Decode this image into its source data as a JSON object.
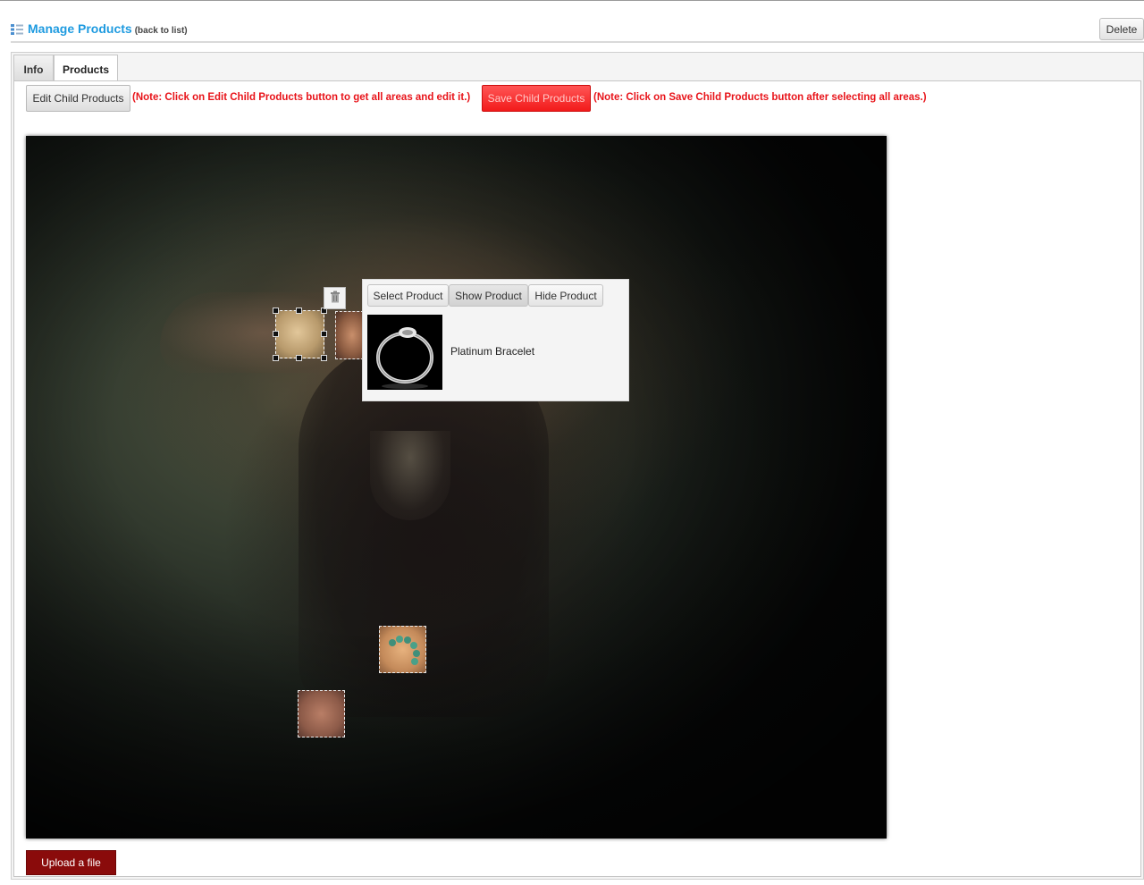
{
  "header": {
    "title": "Manage Products",
    "back_link": "(back to list)",
    "delete_label": "Delete",
    "icon": "list-icon",
    "title_color": "#1f9be0"
  },
  "tabs": [
    {
      "label": "Info",
      "active": false
    },
    {
      "label": "Products",
      "active": true
    }
  ],
  "toolbar": {
    "edit_label": "Edit Child Products",
    "edit_note": "(Note: Click on Edit Child Products button to get all areas and edit it.)",
    "save_label": "Save Child Products",
    "save_note": "(Note: Click on Save Child Products button after selecting all areas.)",
    "note_color": "#e8141a",
    "save_color": "#f21b1b"
  },
  "editor": {
    "delete_area_icon": "trash-icon",
    "hotspots": [
      {
        "name": "hotspot-ring-hand",
        "selected": true
      },
      {
        "name": "hotspot-hair"
      },
      {
        "name": "hotspot-bracelet-wrist"
      },
      {
        "name": "hotspot-knee-hand"
      }
    ],
    "popup": {
      "select_label": "Select Product",
      "show_label": "Show Product",
      "hide_label": "Hide Product",
      "product_name": "Platinum Bracelet",
      "thumbnail": "bracelet-thumbnail"
    }
  },
  "upload": {
    "label": "Upload a file",
    "color": "#8a0b0b"
  }
}
